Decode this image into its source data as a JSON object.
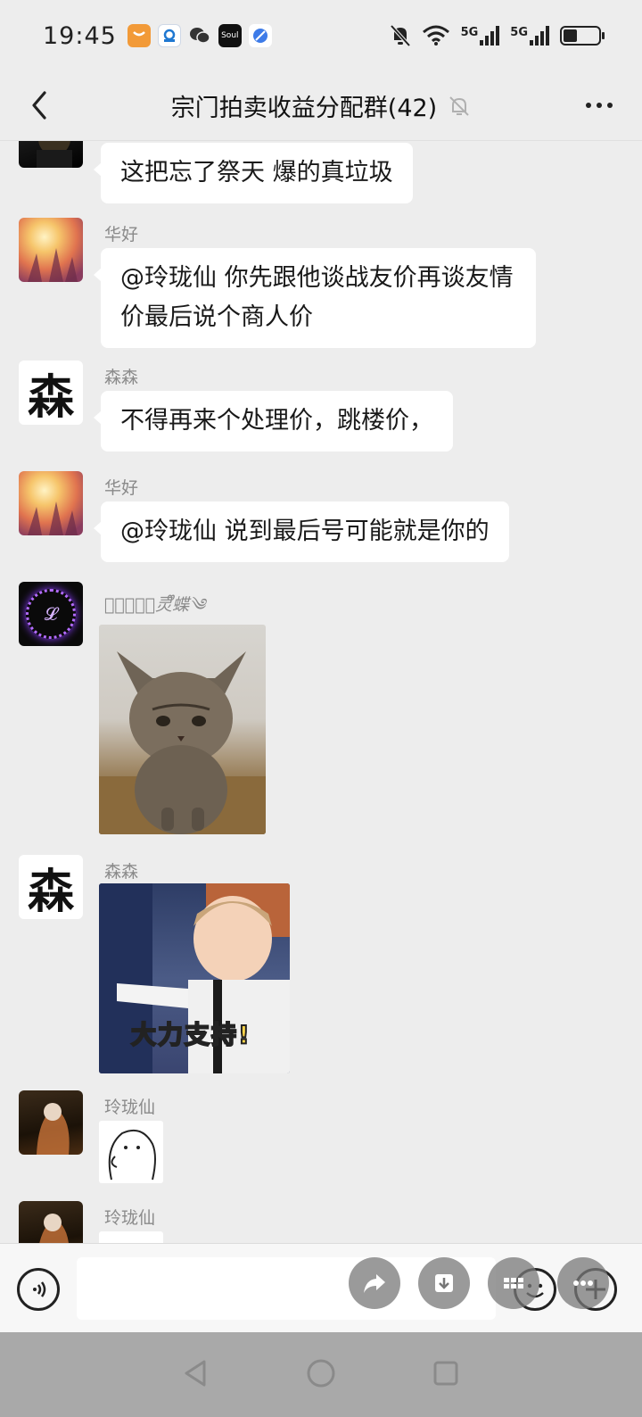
{
  "status_bar": {
    "time": "19:45",
    "app_icons": [
      "shield-app-icon",
      "paypal-app-icon",
      "wechat-icon",
      "soul-app-icon",
      "browser-app-icon"
    ],
    "soul_label": "Soul",
    "network_labels": [
      "5G",
      "5G"
    ],
    "battery_level": 0.4
  },
  "header": {
    "title": "宗门拍卖收益分配群(42)"
  },
  "messages": [
    {
      "sender": "",
      "text": "这把忘了祭天  爆的真垃圾"
    },
    {
      "sender": "华好",
      "text": "@玲珑仙  你先跟他谈战友价再谈友情价最后说个商人价"
    },
    {
      "sender": "森森",
      "text": "不得再来个处理价，跳楼价，"
    },
    {
      "sender": "华好",
      "text": "@玲珑仙  说到最后号可能就是你的"
    },
    {
      "sender": "𝓛𝓸𝓿𝓮ꦿ灵ᩚ蝶༄",
      "type": "image",
      "image": "tabby-cat-sticker"
    },
    {
      "sender": "森森",
      "type": "image",
      "image": "baby-sticker",
      "caption": "大力支持!"
    },
    {
      "sender": "玲珑仙",
      "type": "image",
      "image": "small-doodle-sticker"
    },
    {
      "sender": "玲珑仙",
      "type": "image",
      "image": "small-doodle-sticker"
    }
  ],
  "avatars": {
    "sen_char": "森",
    "purple_char": "𝓛"
  },
  "input_bar": {
    "value": "",
    "placeholder": ""
  }
}
